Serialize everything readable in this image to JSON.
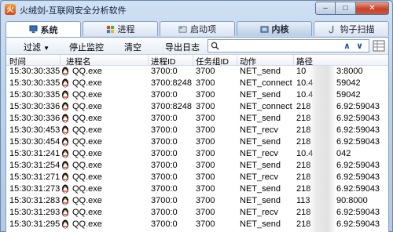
{
  "window": {
    "title": "火绒剑-互联网安全分析软件"
  },
  "tabs": [
    {
      "label": "系统",
      "icon": "monitor-icon"
    },
    {
      "label": "进程",
      "icon": "windows-icon"
    },
    {
      "label": "启动项",
      "icon": "startup-icon"
    },
    {
      "label": "内核",
      "icon": "kernel-icon"
    },
    {
      "label": "钩子扫描",
      "icon": "hook-icon"
    }
  ],
  "toolbar": {
    "filter": "过滤",
    "stop": "停止监控",
    "clear": "清空",
    "export": "导出日志",
    "search_placeholder": ""
  },
  "columns": [
    "时间",
    "进程名",
    "进程ID",
    "任务组ID",
    "动作",
    "路径"
  ],
  "rows": [
    {
      "time": "15:30:30:335",
      "proc": "QQ.exe",
      "pid": "3700:0",
      "gid": "3700",
      "action": "NET_send",
      "path": "10",
      "tail": "3:8000"
    },
    {
      "time": "15:30:30:335",
      "proc": "QQ.exe",
      "pid": "3700:8248",
      "gid": "3700",
      "action": "NET_connect",
      "path": "10.4",
      "tail": "59042"
    },
    {
      "time": "15:30:30:335",
      "proc": "QQ.exe",
      "pid": "3700:0",
      "gid": "3700",
      "action": "NET_send",
      "path": "10.4",
      "tail": "59042"
    },
    {
      "time": "15:30:30:336",
      "proc": "QQ.exe",
      "pid": "3700:8248",
      "gid": "3700",
      "action": "NET_connect",
      "path": "218",
      "tail": "6.92:59043"
    },
    {
      "time": "15:30:30:336",
      "proc": "QQ.exe",
      "pid": "3700:0",
      "gid": "3700",
      "action": "NET_send",
      "path": "218",
      "tail": "6.92:59043"
    },
    {
      "time": "15:30:30:453",
      "proc": "QQ.exe",
      "pid": "3700:0",
      "gid": "3700",
      "action": "NET_recv",
      "path": "218",
      "tail": "6.92:59043"
    },
    {
      "time": "15:30:30:454",
      "proc": "QQ.exe",
      "pid": "3700:0",
      "gid": "3700",
      "action": "NET_send",
      "path": "218",
      "tail": "6.92:59043"
    },
    {
      "time": "15:30:31:241",
      "proc": "QQ.exe",
      "pid": "3700:0",
      "gid": "3700",
      "action": "NET_recv",
      "path": "10.4",
      "tail": "042"
    },
    {
      "time": "15:30:31:254",
      "proc": "QQ.exe",
      "pid": "3700:0",
      "gid": "3700",
      "action": "NET_send",
      "path": "218",
      "tail": "6.92:59043"
    },
    {
      "time": "15:30:31:271",
      "proc": "QQ.exe",
      "pid": "3700:0",
      "gid": "3700",
      "action": "NET_recv",
      "path": "218",
      "tail": "6.92:59043"
    },
    {
      "time": "15:30:31:273",
      "proc": "QQ.exe",
      "pid": "3700:0",
      "gid": "3700",
      "action": "NET_send",
      "path": "218",
      "tail": "6.92:59043"
    },
    {
      "time": "15:30:31:283",
      "proc": "QQ.exe",
      "pid": "3700:0",
      "gid": "3700",
      "action": "NET_send",
      "path": "113",
      "tail": "90:8000"
    },
    {
      "time": "15:30:31:293",
      "proc": "QQ.exe",
      "pid": "3700:0",
      "gid": "3700",
      "action": "NET_recv",
      "path": "218",
      "tail": "6.92:59043"
    },
    {
      "time": "15:30:31:295",
      "proc": "QQ.exe",
      "pid": "3700:0",
      "gid": "3700",
      "action": "NET_send",
      "path": "218",
      "tail": "6.92:59043"
    }
  ]
}
